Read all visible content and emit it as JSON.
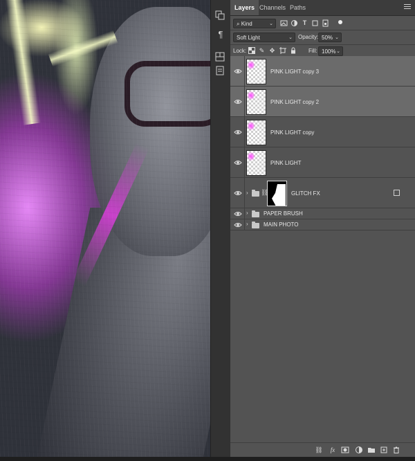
{
  "panel": {
    "tabs": [
      {
        "label": "Layers",
        "active": true
      },
      {
        "label": "Channels",
        "active": false
      },
      {
        "label": "Paths",
        "active": false
      }
    ],
    "filter": {
      "kind_label": "Kind",
      "icons": [
        "image-filter-icon",
        "adjustment-filter-icon",
        "type-filter-icon",
        "shape-filter-icon",
        "smart-object-filter-icon"
      ]
    },
    "blend": {
      "mode": "Soft Light",
      "opacity_label": "Opacity:",
      "opacity_value": "50%"
    },
    "lock": {
      "label": "Lock:",
      "fill_label": "Fill:",
      "fill_value": "100%"
    },
    "layers": [
      {
        "name": "PINK LIGHT copy 3",
        "type": "pixel",
        "selected": true
      },
      {
        "name": "PINK LIGHT copy 2",
        "type": "pixel",
        "selected": true
      },
      {
        "name": "PINK LIGHT copy",
        "type": "pixel",
        "selected": false
      },
      {
        "name": "PINK LIGHT",
        "type": "pixel",
        "selected": false
      },
      {
        "name": "GLITCH FX",
        "type": "group-masked",
        "selected": false
      },
      {
        "name": "PAPER BRUSH",
        "type": "group",
        "selected": false
      },
      {
        "name": "MAIN PHOTO",
        "type": "group",
        "selected": false
      }
    ],
    "bottom_icons": [
      "link-icon",
      "fx-icon",
      "add-mask-icon",
      "adjustment-layer-icon",
      "new-group-icon",
      "new-layer-icon",
      "delete-icon"
    ]
  },
  "toolbar": {
    "icons": [
      "history-icon",
      "paragraph-icon",
      "properties-icon",
      "notes-icon"
    ],
    "paragraph_glyph": "¶"
  },
  "colors": {
    "panel_bg": "#535353",
    "selected_row": "#6b6b6b",
    "tab_bar": "#3c3c3c",
    "accent_pink": "#ff4cff"
  }
}
